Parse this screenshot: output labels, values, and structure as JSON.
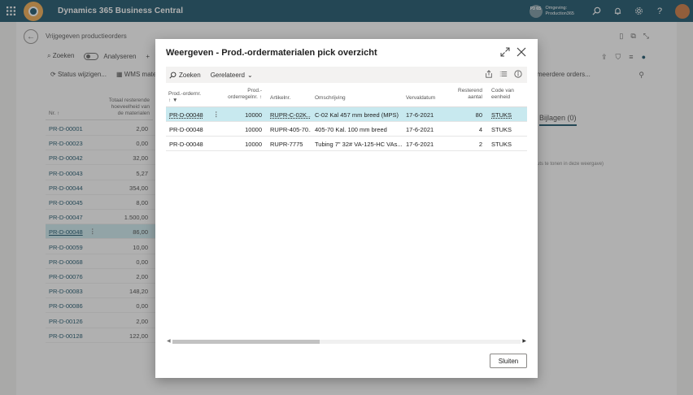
{
  "topbar": {
    "app_title": "Dynamics 365 Business Central",
    "env_badge": "P3 6S",
    "env_label": "Omgeving:",
    "env_name": "Production365",
    "avatar_initials": ""
  },
  "background": {
    "page_caption": "Vrijgegeven productieorders",
    "search_label": "Zoeken",
    "analyze_label": "Analyseren",
    "status_action": "Status wijzigen...",
    "wms_action": "WMS materi",
    "more_orders": "meerdere orders...",
    "attachments_tab": "Bijlagen (0)",
    "attachments_note": "uts te tonen in deze weergave)",
    "col_nr": "Nr. ↑",
    "col_remaining": "Totaal resterende hoeveelheid van de materialen",
    "rows": [
      {
        "nr": "PR-D-00001",
        "amount": "2,00"
      },
      {
        "nr": "PR-D-00023",
        "amount": "0,00"
      },
      {
        "nr": "PR-D-00042",
        "amount": "32,00"
      },
      {
        "nr": "PR-D-00043",
        "amount": "5,27"
      },
      {
        "nr": "PR-D-00044",
        "amount": "354,00"
      },
      {
        "nr": "PR-D-00045",
        "amount": "8,00"
      },
      {
        "nr": "PR-D-00047",
        "amount": "1.500,00"
      },
      {
        "nr": "PR-D-00048",
        "amount": "86,00"
      },
      {
        "nr": "PR-D-00059",
        "amount": "10,00"
      },
      {
        "nr": "PR-D-00068",
        "amount": "0,00"
      },
      {
        "nr": "PR-D-00076",
        "amount": "2,00"
      },
      {
        "nr": "PR-D-00083",
        "amount": "148,20"
      },
      {
        "nr": "PR-D-00086",
        "amount": "0,00"
      },
      {
        "nr": "PR-D-00126",
        "amount": "2,00"
      },
      {
        "nr": "PR-D-00128",
        "amount": "122,00"
      }
    ],
    "selected_row": 7
  },
  "modal": {
    "title": "Weergeven - Prod.-ordermaterialen pick overzicht",
    "search_label": "Zoeken",
    "related_label": "Gerelateerd",
    "columns": {
      "prod_order_nr": "Prod.-ordernr.",
      "prod_order_line": "Prod.-orderregelnr. ↑",
      "item_nr": "Artikelnr.",
      "description": "Omschrijving",
      "due_date": "Vervaldatum",
      "remaining_qty": "Resterend aantal",
      "uom_code": "Code van eenheid"
    },
    "rows": [
      {
        "prod_order_nr": "PR-D-00048",
        "line_nr": "10000",
        "item_nr": "RUPR-C-02K...",
        "description": "C-02 Kal 457 mm breed (MPS)",
        "due_date": "17-6-2021",
        "remaining": "80",
        "uom": "STUKS"
      },
      {
        "prod_order_nr": "PR-D-00048",
        "line_nr": "10000",
        "item_nr": "RUPR-405-70...",
        "description": "405-70 Kal. 100 mm breed",
        "due_date": "17-6-2021",
        "remaining": "4",
        "uom": "STUKS"
      },
      {
        "prod_order_nr": "PR-D-00048",
        "line_nr": "10000",
        "item_nr": "RUPR-7775",
        "description": "Tubing 7\" 32# VA-125-HC VAs...",
        "due_date": "17-6-2021",
        "remaining": "2",
        "uom": "STUKS"
      }
    ],
    "close_button": "Sluiten"
  }
}
